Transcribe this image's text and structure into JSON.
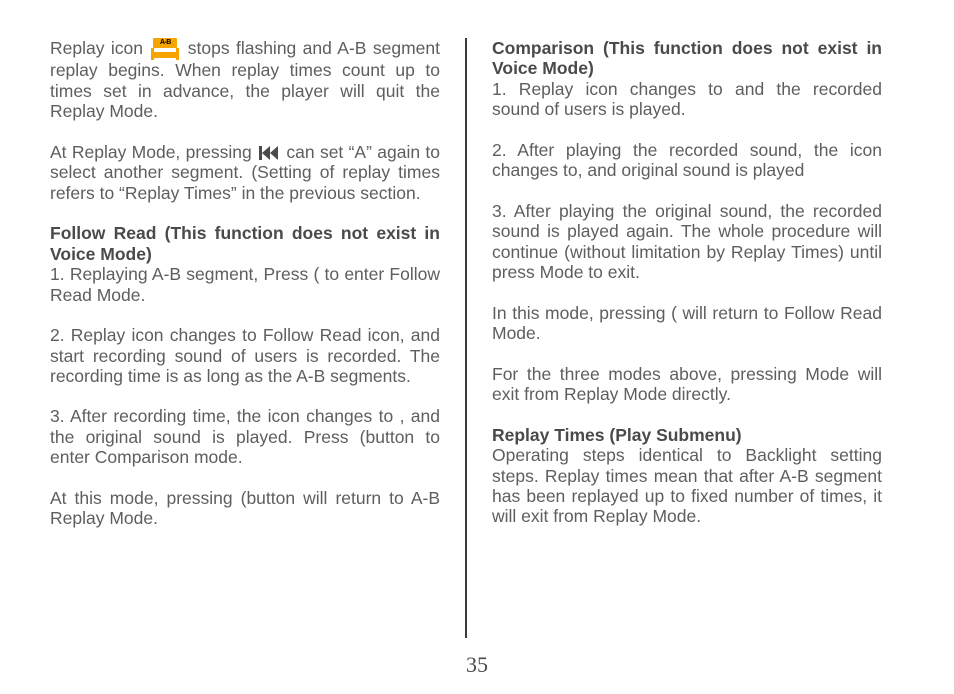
{
  "page_number": "35",
  "left": {
    "p1a": "Replay icon ",
    "ab_icon_label": "A-B",
    "p1b": " stops flashing and A-B segment replay begins. When replay times count up to times set in advance, the player will quit the Replay Mode.",
    "p2a": "At Replay Mode, pressing ",
    "p2b": " can set “A” again to select another segment. (Setting of replay times refers to “Replay Times”  in the previous section.",
    "h1": "Follow Read (This function does not exist in Voice Mode)",
    "p3": "1. Replaying A-B segment, Press ( to enter Follow Read Mode.",
    "p4": "2. Replay icon  changes to Follow Read icon, and start recording sound of users is recorded. The recording time is as long as the A-B segments.",
    "p5": "3. After recording time, the icon changes to , and the original sound is played. Press (button to enter Comparison mode.",
    "p6": "At this mode, pressing (button will return to A-B Replay Mode."
  },
  "right": {
    "h1": "Comparison (This function does not exist in Voice Mode)",
    "p1": "1. Replay icon changes to  and the recorded sound of users is played.",
    "p2": "2. After playing the recorded sound, the icon changes to, and original sound is played",
    "p3": "3. After playing the original sound, the recorded sound is played again. The whole procedure will continue (without limitation by Replay Times) until press Mode to exit.",
    "p4": "In this mode, pressing ( will return to Follow Read Mode.",
    "p5": "For the three modes above, pressing Mode will exit from Replay Mode directly.",
    "h2": "Replay Times (Play Submenu)",
    "p6": "Operating steps identical to Backlight setting steps.   Replay times mean that after A-B segment has been replayed up to fixed number of times, it will exit from Replay Mode."
  }
}
